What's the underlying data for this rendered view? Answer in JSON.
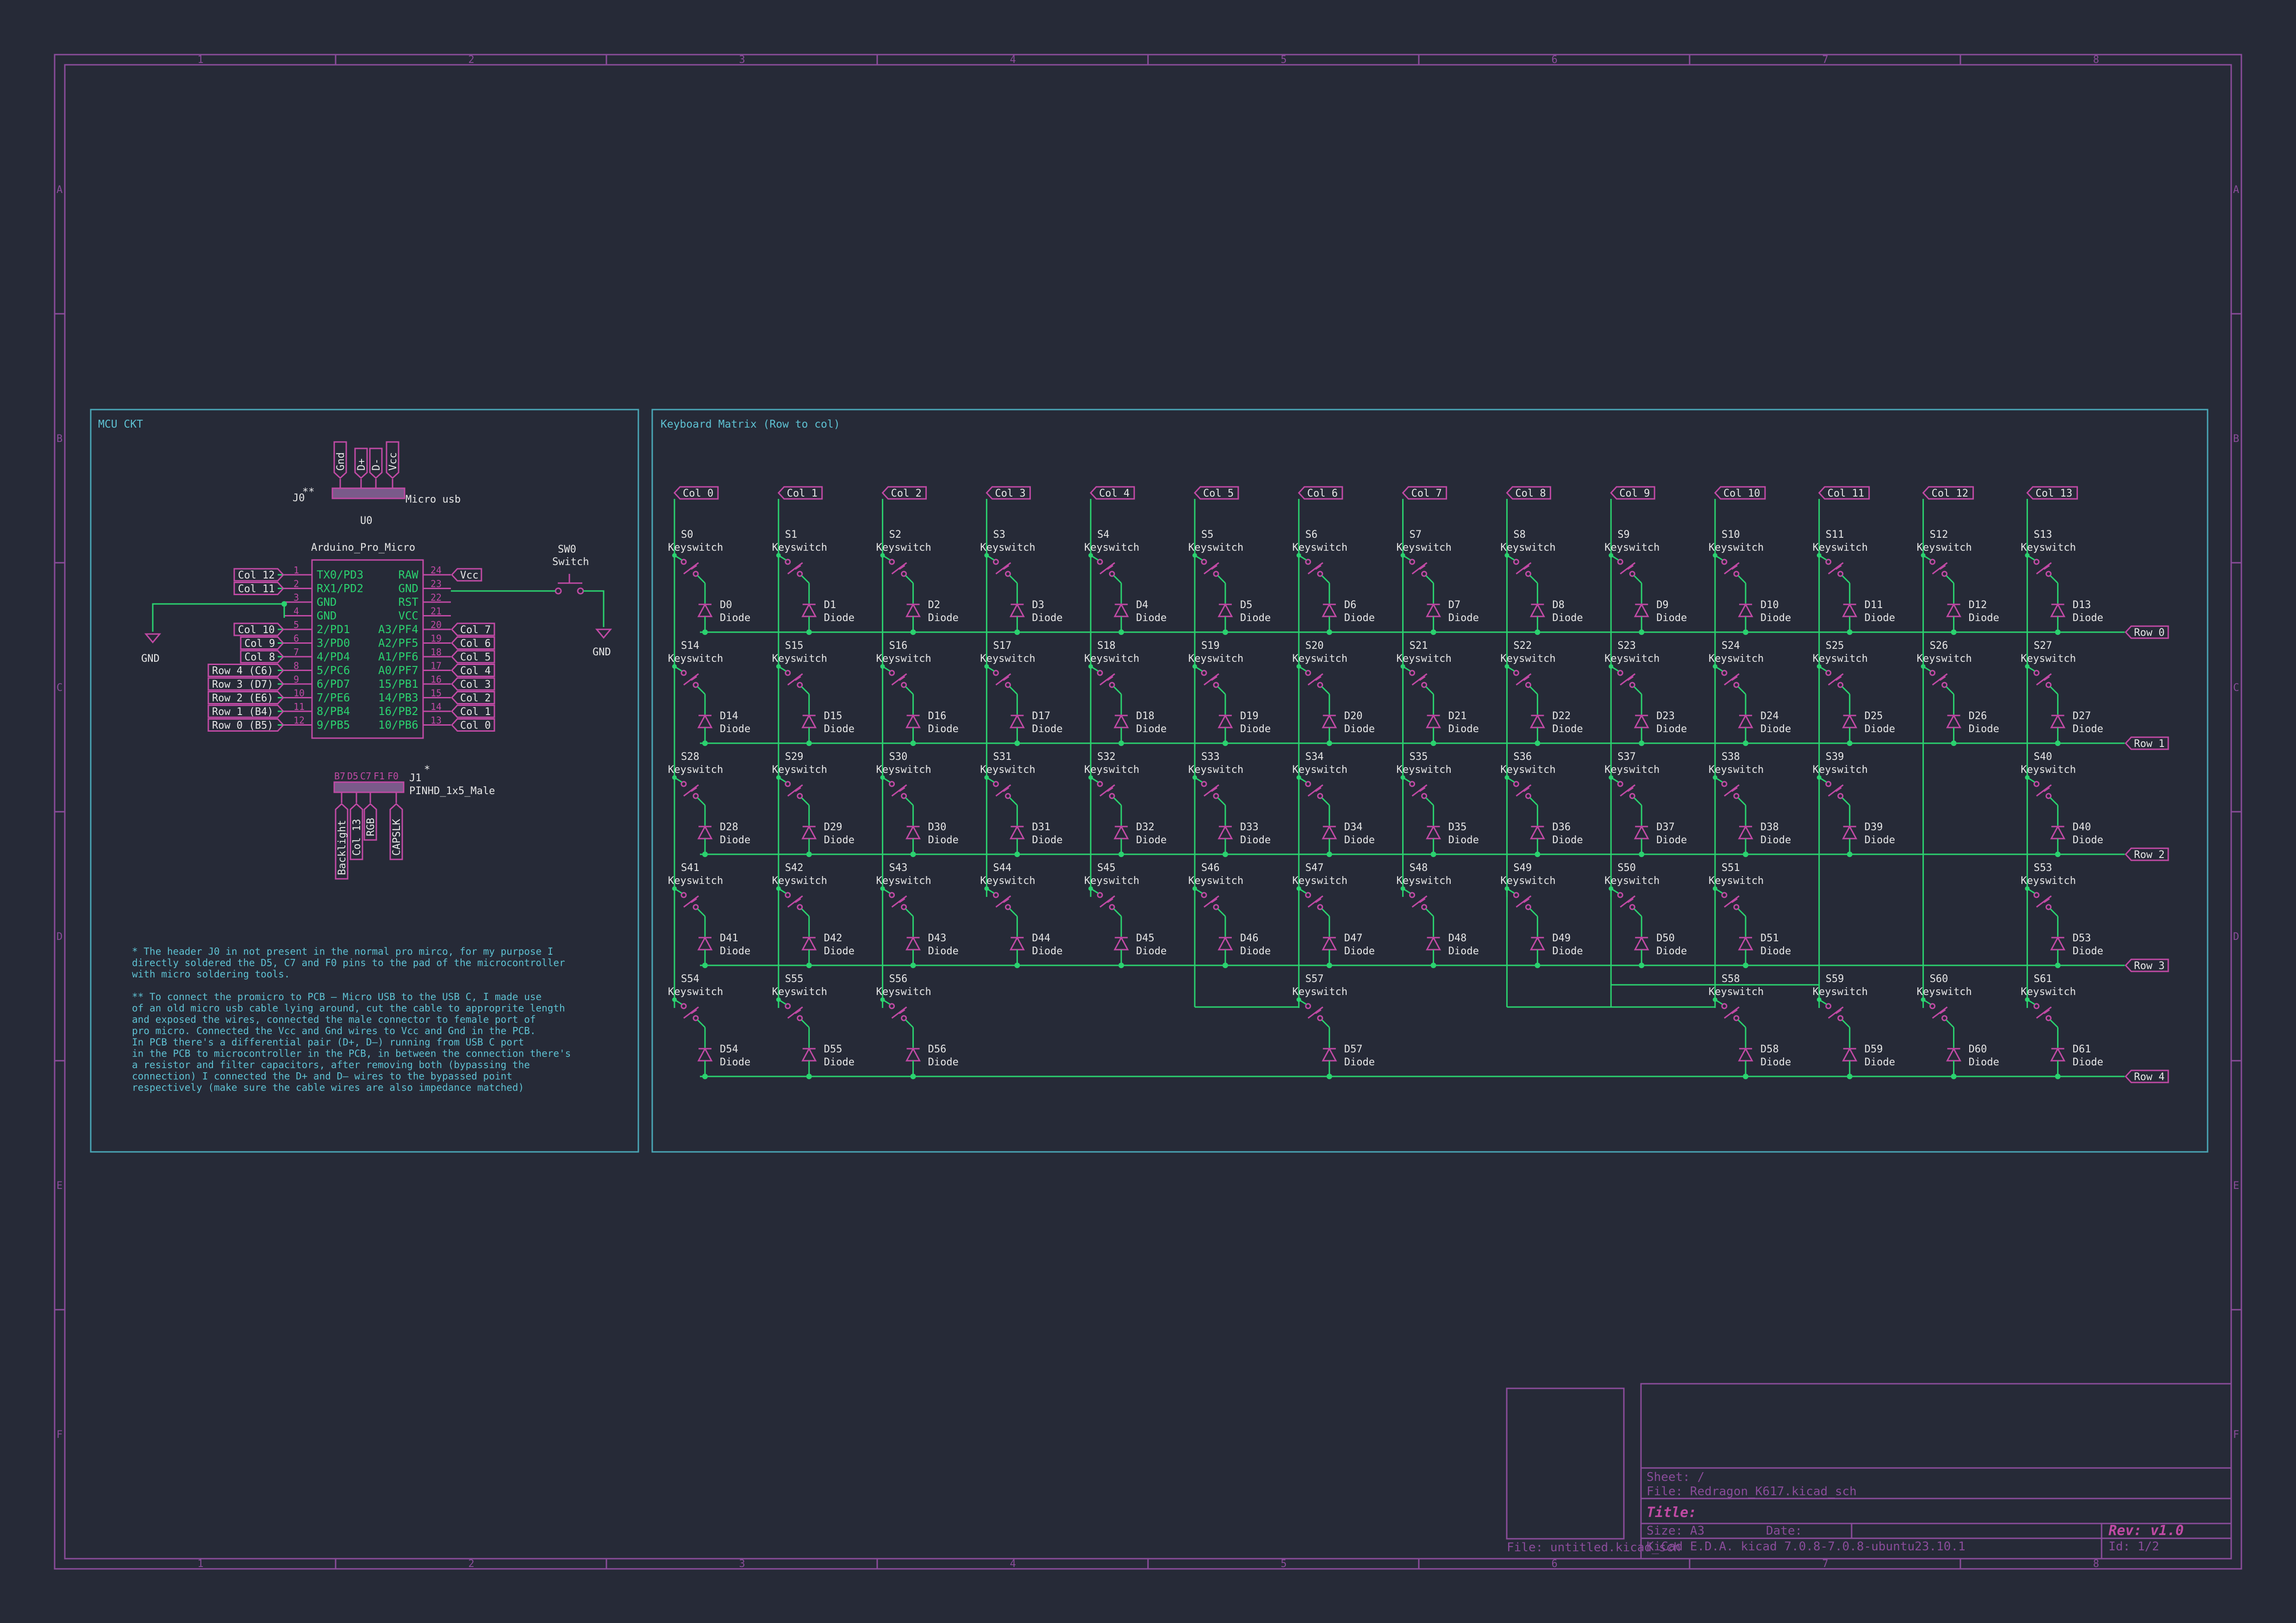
{
  "frame": {
    "col_numbers": [
      "1",
      "2",
      "3",
      "4",
      "5",
      "6",
      "7",
      "8"
    ],
    "row_letters": [
      "A",
      "B",
      "C",
      "D",
      "E",
      "F"
    ]
  },
  "mcu_block": {
    "title": "MCU CKT",
    "j0": {
      "ref": "J0",
      "marker": "**",
      "value": "Micro usb",
      "pin_labels": [
        "Gnd",
        "D+",
        "D-",
        "Vcc"
      ]
    },
    "u0": {
      "ref": "U0",
      "value": "Arduino_Pro_Micro",
      "left_pins": [
        {
          "num": "1",
          "name": "TX0/PD3",
          "net": "Col 12"
        },
        {
          "num": "2",
          "name": "RX1/PD2",
          "net": "Col 11"
        },
        {
          "num": "3",
          "name": "GND",
          "net": ""
        },
        {
          "num": "4",
          "name": "GND",
          "net": ""
        },
        {
          "num": "5",
          "name": "2/PD1",
          "net": "Col 10"
        },
        {
          "num": "6",
          "name": "3/PD0",
          "net": "Col 9"
        },
        {
          "num": "7",
          "name": "4/PD4",
          "net": "Col 8"
        },
        {
          "num": "8",
          "name": "5/PC6",
          "net": "Row 4 (C6)"
        },
        {
          "num": "9",
          "name": "6/PD7",
          "net": "Row 3 (D7)"
        },
        {
          "num": "10",
          "name": "7/PE6",
          "net": "Row 2 (E6)"
        },
        {
          "num": "11",
          "name": "8/PB4",
          "net": "Row 1 (B4)"
        },
        {
          "num": "12",
          "name": "9/PB5",
          "net": "Row 0 (B5)"
        }
      ],
      "right_pins": [
        {
          "num": "24",
          "name": "RAW",
          "net": "Vcc"
        },
        {
          "num": "23",
          "name": "GND",
          "net": ""
        },
        {
          "num": "22",
          "name": "RST",
          "net": ""
        },
        {
          "num": "21",
          "name": "VCC",
          "net": ""
        },
        {
          "num": "20",
          "name": "A3/PF4",
          "net": "Col 7"
        },
        {
          "num": "19",
          "name": "A2/PF5",
          "net": "Col 6"
        },
        {
          "num": "18",
          "name": "A1/PF6",
          "net": "Col 5"
        },
        {
          "num": "17",
          "name": "A0/PF7",
          "net": "Col 4"
        },
        {
          "num": "16",
          "name": "15/PB1",
          "net": "Col 3"
        },
        {
          "num": "15",
          "name": "14/PB3",
          "net": "Col 2"
        },
        {
          "num": "14",
          "name": "16/PB2",
          "net": "Col 1"
        },
        {
          "num": "13",
          "name": "10/PB6",
          "net": "Col 0"
        }
      ]
    },
    "sw0": {
      "ref": "SW0",
      "value": "Switch"
    },
    "gnd_left": "GND",
    "gnd_right": "GND",
    "j1": {
      "ref": "J1",
      "marker": "*",
      "value": "PINHD_1x5_Male",
      "pin_names": [
        "B7",
        "D5",
        "C7",
        "F1",
        "F0"
      ],
      "nets": [
        "Backlight",
        "Col 13",
        "RGB",
        "CAPSLK"
      ]
    },
    "notes": [
      "* The header J0 in not present in the normal pro mirco, for my purpose I",
      "directly soldered the D5, C7 and F0 pins to the pad of the microcontroller",
      "with micro soldering tools.",
      "",
      "** To connect the promicro to PCB – Micro USB to the USB C, I made use",
      "of an old micro usb cable lying around, cut the cable to approprite length",
      "and exposed the wires, connected the male connector to female port of",
      "pro micro. Connected the Vcc and Gnd wires to Vcc and Gnd in the PCB.",
      "In PCB there's a differential pair (D+, D–) running from USB C port",
      "in the PCB to microcontroller in the PCB, in between the connection there's",
      "a resistor and filter capacitors, after removing both (bypassing the",
      "connection) I connected the D+ and D– wires to the bypassed point",
      "respectively (make sure the cable wires are also impedance matched)"
    ]
  },
  "matrix_block": {
    "title": "Keyboard Matrix (Row to col)",
    "switch_value": "Keyswitch",
    "diode_value": "Diode",
    "columns": [
      "Col 0",
      "Col 1",
      "Col 2",
      "Col 3",
      "Col 4",
      "Col 5",
      "Col 6",
      "Col 7",
      "Col 8",
      "Col 9",
      "Col 10",
      "Col 11",
      "Col 12",
      "Col 13"
    ],
    "rows": [
      "Row 0",
      "Row 1",
      "Row 2",
      "Row 3",
      "Row 4"
    ],
    "keys": [
      {
        "s": "S0",
        "d": "D0",
        "r": 0,
        "c": 0
      },
      {
        "s": "S1",
        "d": "D1",
        "r": 0,
        "c": 1
      },
      {
        "s": "S2",
        "d": "D2",
        "r": 0,
        "c": 2
      },
      {
        "s": "S3",
        "d": "D3",
        "r": 0,
        "c": 3
      },
      {
        "s": "S4",
        "d": "D4",
        "r": 0,
        "c": 4
      },
      {
        "s": "S5",
        "d": "D5",
        "r": 0,
        "c": 5
      },
      {
        "s": "S6",
        "d": "D6",
        "r": 0,
        "c": 6
      },
      {
        "s": "S7",
        "d": "D7",
        "r": 0,
        "c": 7
      },
      {
        "s": "S8",
        "d": "D8",
        "r": 0,
        "c": 8
      },
      {
        "s": "S9",
        "d": "D9",
        "r": 0,
        "c": 9
      },
      {
        "s": "S10",
        "d": "D10",
        "r": 0,
        "c": 10
      },
      {
        "s": "S11",
        "d": "D11",
        "r": 0,
        "c": 11
      },
      {
        "s": "S12",
        "d": "D12",
        "r": 0,
        "c": 12
      },
      {
        "s": "S13",
        "d": "D13",
        "r": 0,
        "c": 13
      },
      {
        "s": "S14",
        "d": "D14",
        "r": 1,
        "c": 0
      },
      {
        "s": "S15",
        "d": "D15",
        "r": 1,
        "c": 1
      },
      {
        "s": "S16",
        "d": "D16",
        "r": 1,
        "c": 2
      },
      {
        "s": "S17",
        "d": "D17",
        "r": 1,
        "c": 3
      },
      {
        "s": "S18",
        "d": "D18",
        "r": 1,
        "c": 4
      },
      {
        "s": "S19",
        "d": "D19",
        "r": 1,
        "c": 5
      },
      {
        "s": "S20",
        "d": "D20",
        "r": 1,
        "c": 6
      },
      {
        "s": "S21",
        "d": "D21",
        "r": 1,
        "c": 7
      },
      {
        "s": "S22",
        "d": "D22",
        "r": 1,
        "c": 8
      },
      {
        "s": "S23",
        "d": "D23",
        "r": 1,
        "c": 9
      },
      {
        "s": "S24",
        "d": "D24",
        "r": 1,
        "c": 10
      },
      {
        "s": "S25",
        "d": "D25",
        "r": 1,
        "c": 11
      },
      {
        "s": "S26",
        "d": "D26",
        "r": 1,
        "c": 12
      },
      {
        "s": "S27",
        "d": "D27",
        "r": 1,
        "c": 13
      },
      {
        "s": "S28",
        "d": "D28",
        "r": 2,
        "c": 0
      },
      {
        "s": "S29",
        "d": "D29",
        "r": 2,
        "c": 1
      },
      {
        "s": "S30",
        "d": "D30",
        "r": 2,
        "c": 2
      },
      {
        "s": "S31",
        "d": "D31",
        "r": 2,
        "c": 3
      },
      {
        "s": "S32",
        "d": "D32",
        "r": 2,
        "c": 4
      },
      {
        "s": "S33",
        "d": "D33",
        "r": 2,
        "c": 5
      },
      {
        "s": "S34",
        "d": "D34",
        "r": 2,
        "c": 6
      },
      {
        "s": "S35",
        "d": "D35",
        "r": 2,
        "c": 7
      },
      {
        "s": "S36",
        "d": "D36",
        "r": 2,
        "c": 8
      },
      {
        "s": "S37",
        "d": "D37",
        "r": 2,
        "c": 9
      },
      {
        "s": "S38",
        "d": "D38",
        "r": 2,
        "c": 10
      },
      {
        "s": "S39",
        "d": "D39",
        "r": 2,
        "c": 11
      },
      {
        "s": "S40",
        "d": "D40",
        "r": 2,
        "c": 13
      },
      {
        "s": "S41",
        "d": "D41",
        "r": 3,
        "c": 0
      },
      {
        "s": "S42",
        "d": "D42",
        "r": 3,
        "c": 1
      },
      {
        "s": "S43",
        "d": "D43",
        "r": 3,
        "c": 2
      },
      {
        "s": "S44",
        "d": "D44",
        "r": 3,
        "c": 3
      },
      {
        "s": "S45",
        "d": "D45",
        "r": 3,
        "c": 4
      },
      {
        "s": "S46",
        "d": "D46",
        "r": 3,
        "c": 5
      },
      {
        "s": "S47",
        "d": "D47",
        "r": 3,
        "c": 6
      },
      {
        "s": "S48",
        "d": "D48",
        "r": 3,
        "c": 7
      },
      {
        "s": "S49",
        "d": "D49",
        "r": 3,
        "c": 8
      },
      {
        "s": "S50",
        "d": "D50",
        "r": 3,
        "c": 9
      },
      {
        "s": "S51",
        "d": "D51",
        "r": 3,
        "c": 10
      },
      {
        "s": "S53",
        "d": "D53",
        "r": 3,
        "c": 13
      },
      {
        "s": "S54",
        "d": "D54",
        "r": 4,
        "c": 0
      },
      {
        "s": "S55",
        "d": "D55",
        "r": 4,
        "c": 1
      },
      {
        "s": "S56",
        "d": "D56",
        "r": 4,
        "c": 2
      },
      {
        "s": "S57",
        "d": "D57",
        "r": 4,
        "c": 6
      },
      {
        "s": "S58",
        "d": "D58",
        "r": 4,
        "c": 10
      },
      {
        "s": "S59",
        "d": "D59",
        "r": 4,
        "c": 11
      },
      {
        "s": "S60",
        "d": "D60",
        "r": 4,
        "c": 12
      },
      {
        "s": "S61",
        "d": "D61",
        "r": 4,
        "c": 13
      }
    ]
  },
  "title_block": {
    "sub_file": "File: untitled.kicad_sch",
    "sheet": "Sheet: /",
    "file": "File: Redragon_K617.kicad_sch",
    "title": "Title:",
    "size": "Size: A3",
    "date": "Date:",
    "rev": "Rev: v1.0",
    "tool": "KiCad E.D.A.  kicad 7.0.8-7.0.8-ubuntu23.10.1",
    "id": "Id: 1/2"
  },
  "colors": {
    "background": "#262a37",
    "frame": "#8a4c9a",
    "wire": "#2bd16f",
    "symbol": "#c04aa4",
    "text": "#e6e6e6",
    "note": "#5ec1d2"
  }
}
